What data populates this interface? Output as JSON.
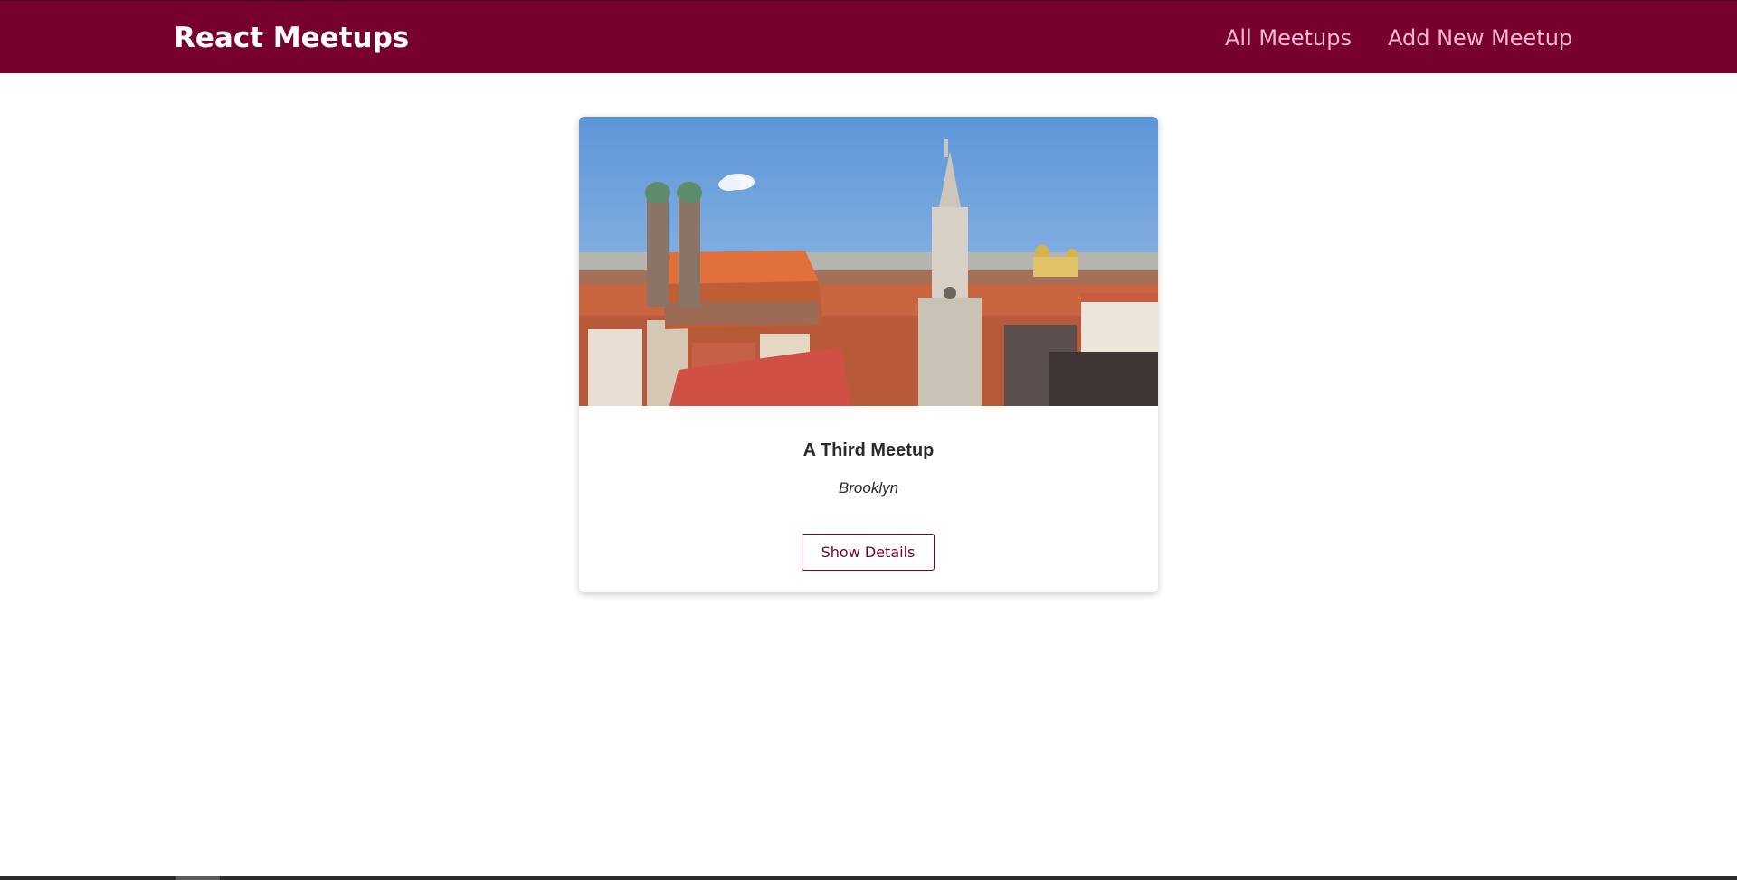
{
  "header": {
    "logo": "React Meetups",
    "nav": {
      "all_meetups": "All Meetups",
      "add_new_meetup": "Add New Meetup"
    }
  },
  "meetup": {
    "image_alt": "A Third Meetup",
    "title": "A Third Meetup",
    "address": "Brooklyn",
    "details_button": "Show Details"
  },
  "colors": {
    "brand": "#77002e",
    "nav_link": "#fcb8d2",
    "text": "#2c292b"
  }
}
